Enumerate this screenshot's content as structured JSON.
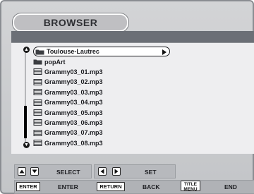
{
  "header": {
    "title": "BROWSER"
  },
  "file_list": {
    "items": [
      {
        "type": "folder",
        "label": "Toulouse-Lautrec",
        "selected": true,
        "icon": "folder-icon"
      },
      {
        "type": "folder",
        "label": "popArt",
        "selected": false,
        "icon": "folder-icon"
      },
      {
        "type": "file",
        "label": "Grammy03_01.mp3",
        "selected": false,
        "icon": "audio-file-icon"
      },
      {
        "type": "file",
        "label": "Grammy03_02.mp3",
        "selected": false,
        "icon": "audio-file-icon"
      },
      {
        "type": "file",
        "label": "Grammy03_03.mp3",
        "selected": false,
        "icon": "audio-file-icon"
      },
      {
        "type": "file",
        "label": "Grammy03_04.mp3",
        "selected": false,
        "icon": "audio-file-icon"
      },
      {
        "type": "file",
        "label": "Grammy03_05.mp3",
        "selected": false,
        "icon": "audio-file-icon"
      },
      {
        "type": "file",
        "label": "Grammy03_06.mp3",
        "selected": false,
        "icon": "audio-file-icon"
      },
      {
        "type": "file",
        "label": "Grammy03_07.mp3",
        "selected": false,
        "icon": "audio-file-icon"
      },
      {
        "type": "file",
        "label": "Grammy03_08.mp3",
        "selected": false,
        "icon": "audio-file-icon"
      }
    ]
  },
  "footer": {
    "select_label": "SELECT",
    "set_label": "SET",
    "enter_key": "ENTER",
    "enter_label": "ENTER",
    "return_key": "RETURN",
    "back_label": "BACK",
    "title_menu_key_line1": "TITLE",
    "title_menu_key_line2": "MENU",
    "end_label": "END"
  },
  "colors": {
    "background": "#c8c9cc",
    "band": "#6b6f76",
    "panel": "#eeeef0",
    "text": "#1b1c20"
  }
}
